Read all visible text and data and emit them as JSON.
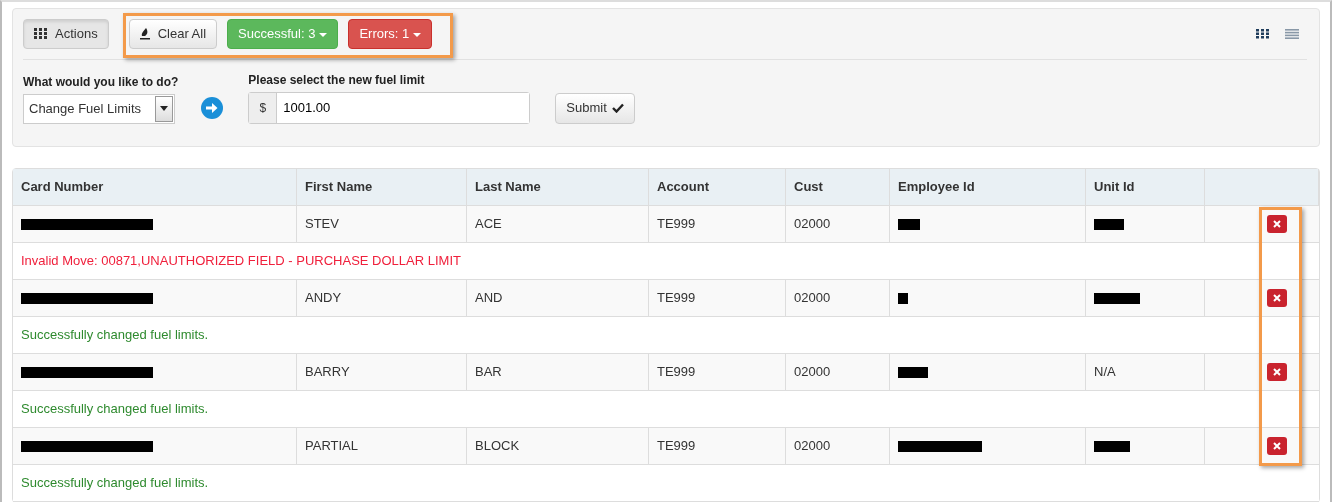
{
  "toolbar": {
    "actions_button": "Actions",
    "clear_button": "Clear All",
    "successful_button": "Successful: 3",
    "errors_button": "Errors: 1",
    "view_modes": [
      {
        "kind": "grid",
        "selected": true
      },
      {
        "kind": "list",
        "selected": false
      }
    ]
  },
  "form": {
    "action_label": "What would you like to do?",
    "action_value": "Change Fuel Limits",
    "limit_label": "Please select the new fuel limit",
    "currency": "$",
    "limit_value": "1001.00",
    "submit_button": "Submit"
  },
  "table": {
    "columns": [
      "Card Number",
      "First Name",
      "Last Name",
      "Account",
      "Cust",
      "Employee Id",
      "Unit Id"
    ],
    "rows": [
      {
        "cells": [
          {
            "kind": "redacted"
          },
          {
            "kind": "text",
            "text": "STEV"
          },
          {
            "kind": "text",
            "text": "ACE"
          },
          {
            "kind": "text",
            "text": "TE999"
          },
          {
            "kind": "text",
            "text": "02000"
          },
          {
            "kind": "redacted"
          },
          {
            "kind": "redacted"
          }
        ],
        "message": {
          "kind": "error",
          "text": "Invalid Move: 00871,UNAUTHORIZED FIELD - PURCHASE DOLLAR LIMIT"
        }
      },
      {
        "cells": [
          {
            "kind": "redacted"
          },
          {
            "kind": "text",
            "text": "ANDY"
          },
          {
            "kind": "text",
            "text": "AND"
          },
          {
            "kind": "text",
            "text": "TE999"
          },
          {
            "kind": "text",
            "text": "02000"
          },
          {
            "kind": "redacted"
          },
          {
            "kind": "redacted"
          }
        ],
        "message": {
          "kind": "success",
          "text": "Successfully changed fuel limits."
        }
      },
      {
        "cells": [
          {
            "kind": "redacted"
          },
          {
            "kind": "text",
            "text": "BARRY"
          },
          {
            "kind": "text",
            "text": "BAR"
          },
          {
            "kind": "text",
            "text": "TE999"
          },
          {
            "kind": "text",
            "text": "02000"
          },
          {
            "kind": "redacted"
          },
          {
            "kind": "text",
            "text": "N/A"
          }
        ],
        "message": {
          "kind": "success",
          "text": "Successfully changed fuel limits."
        }
      },
      {
        "cells": [
          {
            "kind": "redacted"
          },
          {
            "kind": "text",
            "text": "PARTIAL"
          },
          {
            "kind": "text",
            "text": "BLOCK"
          },
          {
            "kind": "text",
            "text": "TE999"
          },
          {
            "kind": "text",
            "text": "02000"
          },
          {
            "kind": "redacted"
          },
          {
            "kind": "redacted"
          }
        ],
        "message": {
          "kind": "success",
          "text": "Successfully changed fuel limits."
        }
      }
    ]
  }
}
